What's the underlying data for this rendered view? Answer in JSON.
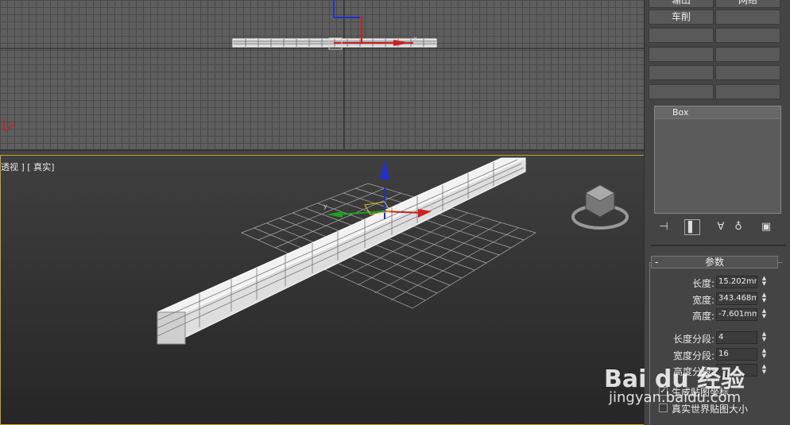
{
  "viewports": {
    "top": {
      "name": "top-viewport"
    },
    "perspective": {
      "label": "透视 ] [ 真实]"
    }
  },
  "command_panel": {
    "modifier_buttons": [
      "输出",
      "网络",
      "车削",
      "",
      "",
      "",
      "",
      "",
      "",
      "",
      "",
      ""
    ],
    "modifier_stack": {
      "items": [
        "Box"
      ]
    },
    "parameters": {
      "title": "参数",
      "collapse_symbol": "-",
      "length_label": "长度:",
      "length_value": "15.202mm",
      "width_label": "宽度:",
      "width_value": "343.468m",
      "height_label": "高度:",
      "height_value": "-7.601mm",
      "length_segs_label": "长度分段:",
      "length_segs_value": "4",
      "width_segs_label": "宽度分段:",
      "width_segs_value": "16",
      "height_segs_label": "高度分段:",
      "height_segs_value": "",
      "gen_mapping_label": "生成贴图坐标",
      "gen_mapping_checked": "✓",
      "real_world_label": "真实世界贴图大小",
      "real_world_checked": ""
    },
    "icons": [
      "pin-stack-icon",
      "show-end-result-icon",
      "make-unique-icon",
      "remove-modifier-icon",
      "configure-sets-icon"
    ]
  },
  "watermark": {
    "logo": "Bai du 经验",
    "url": "jingyan.baidu.com"
  },
  "colors": {
    "viewport_border_active": "#c9a227",
    "gizmo_x": "#cc2020",
    "gizmo_y": "#20a020",
    "gizmo_z": "#2030d0"
  }
}
